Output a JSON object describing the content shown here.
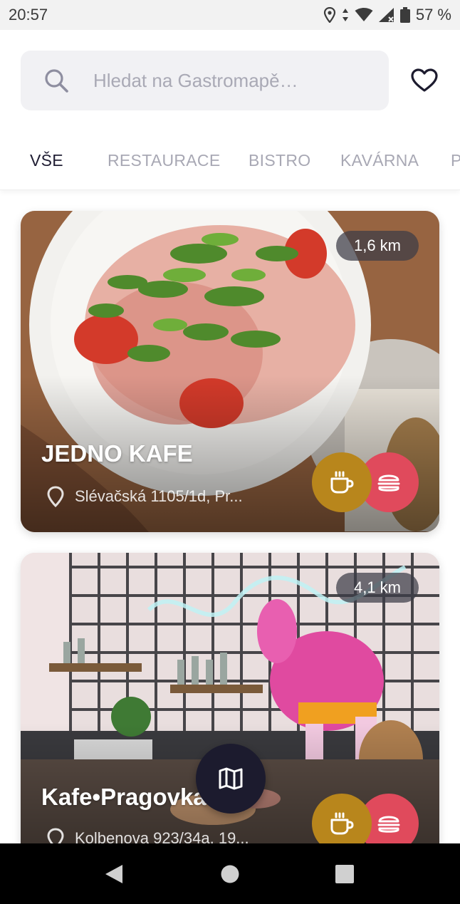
{
  "status_bar": {
    "time": "20:57",
    "battery": "57 %",
    "icons": [
      "location-icon",
      "data-arrows-icon",
      "wifi-icon",
      "signal-icon",
      "battery-icon"
    ]
  },
  "search": {
    "placeholder": "Hledat na Gastromapě…",
    "value": ""
  },
  "tabs": [
    {
      "label": "VŠE",
      "active": true
    },
    {
      "label": "RESTAURACE",
      "active": false
    },
    {
      "label": "BISTRO",
      "active": false
    },
    {
      "label": "KAVÁRNA",
      "active": false
    },
    {
      "label": "P",
      "active": false
    }
  ],
  "places": [
    {
      "name": "JEDNO KAFE",
      "address": "Slévačská 1105/1d, Pr...",
      "distance": "1,6 km",
      "categories": [
        "coffee-icon",
        "burger-icon"
      ]
    },
    {
      "name": "Kafe•Pragovka",
      "address": "Kolbenova 923/34a, 19...",
      "distance": "4,1 km",
      "categories": [
        "coffee-icon",
        "burger-icon"
      ]
    }
  ],
  "colors": {
    "accent_dark": "#1c1b2e",
    "coffee_badge": "#b8861c",
    "food_badge": "#e04a5c",
    "tab_inactive": "#a8a8b4",
    "tab_active": "#1f1d33"
  }
}
